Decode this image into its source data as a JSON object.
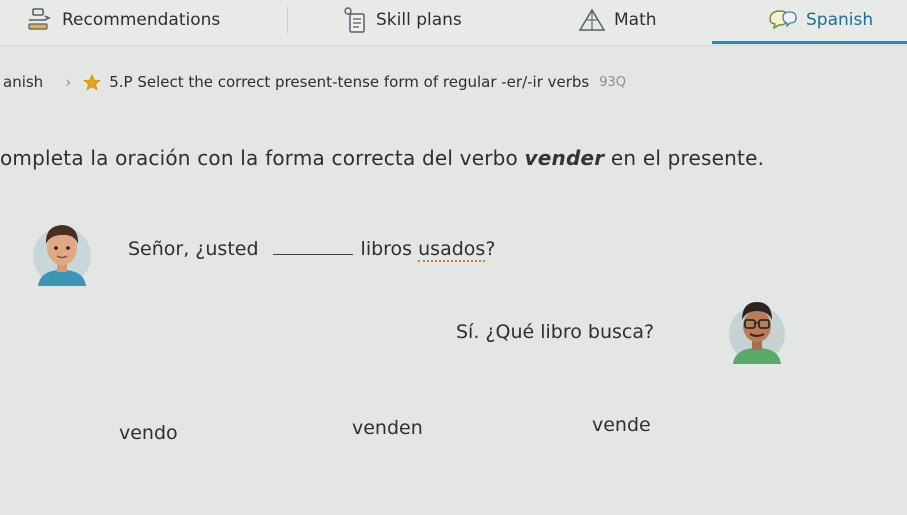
{
  "nav": {
    "items": [
      {
        "label": "Recommendations",
        "icon": "recommendations-icon"
      },
      {
        "label": "Skill plans",
        "icon": "skill-plans-icon"
      },
      {
        "label": "Math",
        "icon": "math-icon"
      },
      {
        "label": "Spanish",
        "icon": "spanish-icon"
      }
    ],
    "active": "Spanish",
    "accent_color": "#1f8fb6"
  },
  "breadcrumb": {
    "subject": "anish",
    "skill": "5.P Select the correct present-tense form of regular -er/-ir verbs",
    "code": "93Q",
    "star_color": "#e8a21c"
  },
  "prompt": {
    "before": "ompleta la oración con la forma correcta del verbo ",
    "verb": "vender",
    "after": " en el presente."
  },
  "dialogue": {
    "line1": {
      "before": "Señor, ¿usted",
      "after_word": "libros",
      "underlined": "usados",
      "end": "?"
    },
    "line2": "Sí. ¿Qué libro busca?"
  },
  "choices": [
    "vendo",
    "venden",
    "vende"
  ]
}
